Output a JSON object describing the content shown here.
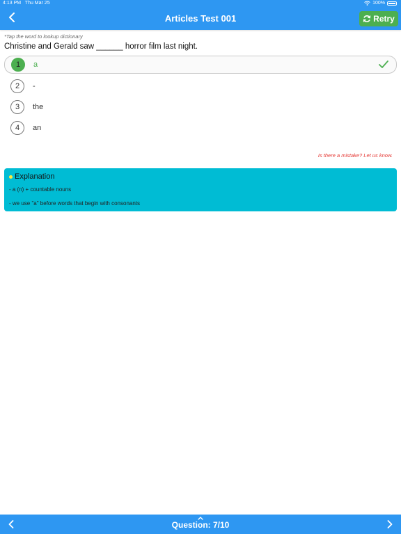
{
  "status": {
    "time": "4:13 PM",
    "date": "Thu Mar 25",
    "battery": "100%"
  },
  "header": {
    "title": "Articles Test 001",
    "retry_label": "Retry"
  },
  "hint": "*Tap the word to lookup dictionary",
  "question": "Christine and Gerald saw ______ horror film last night.",
  "options": [
    {
      "num": "1",
      "text": "a"
    },
    {
      "num": "2",
      "text": "-"
    },
    {
      "num": "3",
      "text": "the"
    },
    {
      "num": "4",
      "text": "an"
    }
  ],
  "selected_option": "1",
  "report_link": "Is there a mistake? Let us know.",
  "explanation": {
    "title": "Explanation",
    "lines": [
      "- a (n) + countable nouns",
      "- we use \"a\" before words that begin with consonants"
    ]
  },
  "footer": {
    "counter": "Question: 7/10"
  },
  "colors": {
    "primary": "#2e97f2",
    "correct": "#4caf50",
    "explanation_bg": "#00bcd4",
    "error": "#e53935"
  }
}
